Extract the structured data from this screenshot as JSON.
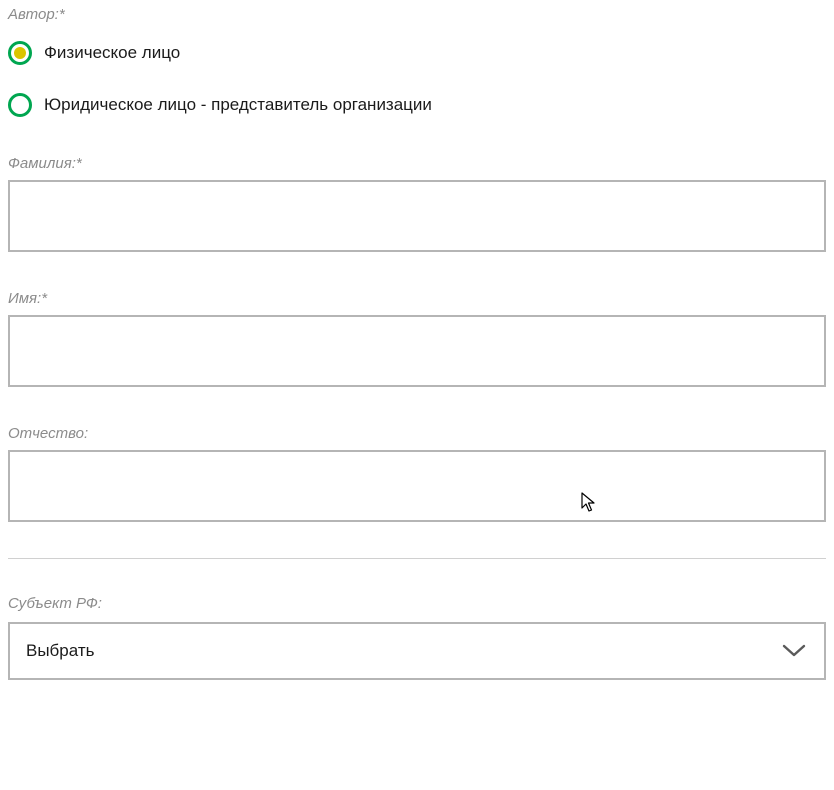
{
  "author_label": "Автор:*",
  "radios": {
    "individual": "Физическое лицо",
    "legal": "Юридическое лицо - представитель организации"
  },
  "fields": {
    "surname_label": "Фамилия:*",
    "surname_value": "",
    "name_label": "Имя:*",
    "name_value": "",
    "patronymic_label": "Отчество:",
    "patronymic_value": ""
  },
  "region": {
    "label": "Субъект РФ:",
    "placeholder_text": "Выбрать"
  }
}
